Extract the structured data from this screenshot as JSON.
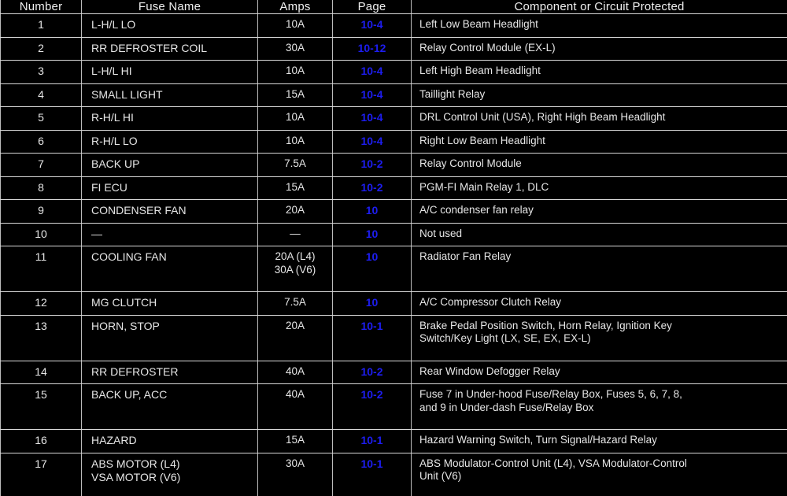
{
  "table": {
    "columns": [
      {
        "key": "number",
        "label": "Number"
      },
      {
        "key": "fuse_name",
        "label": "Fuse Name"
      },
      {
        "key": "amps",
        "label": "Amps"
      },
      {
        "key": "page",
        "label": "Page"
      },
      {
        "key": "component",
        "label": "Component or Circuit Protected"
      }
    ],
    "link_color": "#1d1df0",
    "text_color": "#e6e6e6",
    "background_color": "#000000",
    "border_color": "#d8d8d8",
    "rows": [
      {
        "number": "1",
        "fuse_name": "L-H/L LO",
        "amps": "10A",
        "page": "10-4",
        "component": "Left Low Beam Headlight",
        "component_line2": ""
      },
      {
        "number": "2",
        "fuse_name": "RR DEFROSTER COIL",
        "amps": "30A",
        "page": "10-12",
        "component": "Relay Control Module (EX-L)",
        "component_line2": ""
      },
      {
        "number": "3",
        "fuse_name": "L-H/L HI",
        "amps": "10A",
        "page": "10-4",
        "component": "Left High Beam Headlight",
        "component_line2": ""
      },
      {
        "number": "4",
        "fuse_name": "SMALL LIGHT",
        "amps": "15A",
        "page": "10-4",
        "component": "Taillight Relay",
        "component_line2": ""
      },
      {
        "number": "5",
        "fuse_name": "R-H/L HI",
        "amps": "10A",
        "page": "10-4",
        "component": "DRL Control Unit (USA), Right High Beam Headlight",
        "component_line2": ""
      },
      {
        "number": "6",
        "fuse_name": "R-H/L LO",
        "amps": "10A",
        "page": "10-4",
        "component": "Right Low Beam Headlight",
        "component_line2": ""
      },
      {
        "number": "7",
        "fuse_name": "BACK UP",
        "amps": "7.5A",
        "page": "10-2",
        "component": "Relay Control Module",
        "component_line2": ""
      },
      {
        "number": "8",
        "fuse_name": "FI ECU",
        "amps": "15A",
        "page": "10-2",
        "component": "PGM-FI Main Relay 1, DLC",
        "component_line2": ""
      },
      {
        "number": "9",
        "fuse_name": "CONDENSER FAN",
        "amps": "20A",
        "page": "10",
        "component": "A/C condenser fan relay",
        "component_line2": ""
      },
      {
        "number": "10",
        "fuse_name": "—",
        "amps": "—",
        "page": "10",
        "component": "Not used",
        "component_line2": ""
      },
      {
        "number": "11",
        "fuse_name": "COOLING FAN",
        "amps": "20A (L4)",
        "amps_line2": "30A (V6)",
        "page": "10",
        "component": "Radiator Fan Relay",
        "component_line2": ""
      },
      {
        "number": "12",
        "fuse_name": "MG CLUTCH",
        "amps": "7.5A",
        "page": "10",
        "component": "A/C Compressor Clutch Relay",
        "component_line2": ""
      },
      {
        "number": "13",
        "fuse_name": "HORN, STOP",
        "amps": "20A",
        "page": "10-1",
        "component": "Brake Pedal Position Switch, Horn Relay, Ignition Key",
        "component_line2": "Switch/Key Light (LX, SE, EX, EX-L)"
      },
      {
        "number": "14",
        "fuse_name": "RR DEFROSTER",
        "amps": "40A",
        "page": "10-2",
        "component": "Rear Window Defogger Relay",
        "component_line2": ""
      },
      {
        "number": "15",
        "fuse_name": "BACK UP, ACC",
        "amps": "40A",
        "page": "10-2",
        "component": "Fuse 7 in Under-hood Fuse/Relay Box, Fuses 5, 6, 7, 8,",
        "component_line2": "and 9 in Under-dash Fuse/Relay Box"
      },
      {
        "number": "16",
        "fuse_name": "HAZARD",
        "amps": "15A",
        "page": "10-1",
        "component": "Hazard Warning Switch, Turn Signal/Hazard Relay",
        "component_line2": ""
      },
      {
        "number": "17",
        "fuse_name": "ABS MOTOR (L4)",
        "fuse_name_line2": "VSA MOTOR (V6)",
        "amps": "30A",
        "page": "10-1",
        "component": "ABS Modulator-Control Unit (L4), VSA Modulator-Control",
        "component_line2": "Unit (V6)"
      }
    ]
  }
}
